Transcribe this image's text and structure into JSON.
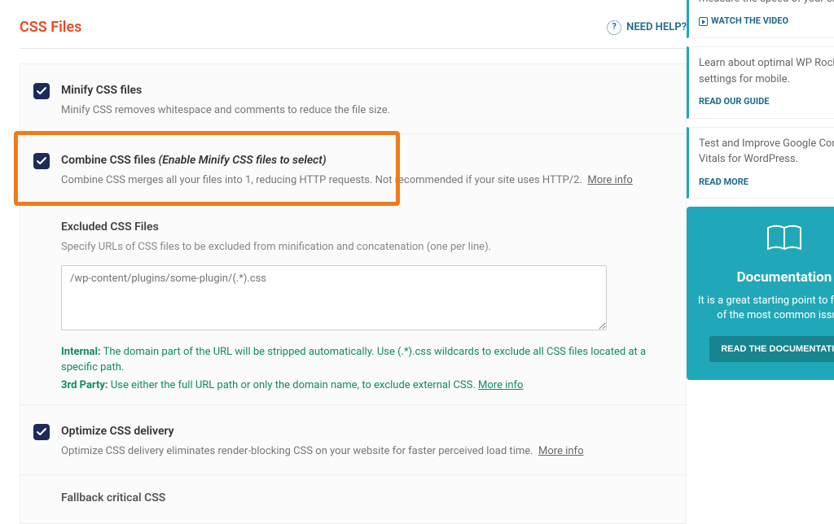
{
  "header": {
    "title": "CSS Files",
    "help_label": "NEED HELP?"
  },
  "settings": {
    "minify": {
      "label": "Minify CSS files",
      "desc": "Minify CSS removes whitespace and comments to reduce the file size."
    },
    "combine": {
      "label": "Combine CSS files",
      "hint": "(Enable Minify CSS files to select)",
      "desc": "Combine CSS merges all your files into 1, reducing HTTP requests. Not recommended if your site uses HTTP/2.",
      "more": "More info"
    },
    "excluded": {
      "label": "Excluded CSS Files",
      "desc": "Specify URLs of CSS files to be excluded from minification and concatenation (one per line).",
      "placeholder": "/wp-content/plugins/some-plugin/(.*).css",
      "note_internal_label": "Internal:",
      "note_internal": "The domain part of the URL will be stripped automatically. Use (.*).css wildcards to exclude all CSS files located at a specific path.",
      "note_3rd_label": "3rd Party:",
      "note_3rd": "Use either the full URL path or only the domain name, to exclude external CSS.",
      "note_more": "More info"
    },
    "optimize": {
      "label": "Optimize CSS delivery",
      "desc": "Optimize CSS delivery eliminates render-blocking CSS on your website for faster perceived load time.",
      "more": "More info"
    },
    "fallback": {
      "label": "Fallback critical CSS"
    }
  },
  "sidebar": {
    "card1": {
      "text": "measure the speed of your site.",
      "link": "WATCH THE VIDEO"
    },
    "card2": {
      "text1": "Learn about optimal WP Rocket",
      "text2": "settings for mobile.",
      "link": "READ OUR GUIDE"
    },
    "card3": {
      "text1": "Test and Improve Google Core Web",
      "text2": "Vitals for WordPress.",
      "link": "READ MORE"
    },
    "doc": {
      "title": "Documentation",
      "desc1": "It is a great starting point to fix some",
      "desc2": "of the most common issues.",
      "button": "READ THE DOCUMENTATION"
    }
  }
}
